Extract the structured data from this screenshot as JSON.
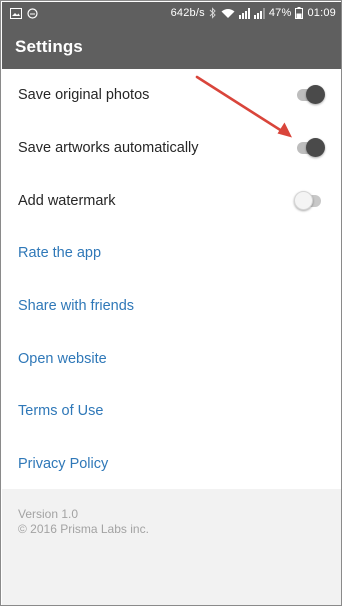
{
  "status_bar": {
    "speed": "642b/s",
    "battery": "47%",
    "time": "01:09",
    "left_icons": [
      "image-icon",
      "circle-icon"
    ],
    "right_icons": [
      "bluetooth-icon",
      "wifi-icon",
      "signal-icon",
      "signal-icon",
      "battery-icon"
    ]
  },
  "appbar": {
    "title": "Settings"
  },
  "toggles": [
    {
      "label": "Save original photos",
      "state": "on"
    },
    {
      "label": "Save artworks automatically",
      "state": "on"
    },
    {
      "label": "Add watermark",
      "state": "off"
    }
  ],
  "links": [
    {
      "label": "Rate the app"
    },
    {
      "label": "Share with friends"
    },
    {
      "label": "Open website"
    },
    {
      "label": "Terms of Use"
    },
    {
      "label": "Privacy Policy"
    }
  ],
  "footer": {
    "version": "Version 1.0",
    "copyright": "© 2016 Prisma Labs inc."
  },
  "colors": {
    "bar": "#5f5f5f",
    "link": "#2f78b8",
    "annotation_arrow": "#d9453b"
  }
}
